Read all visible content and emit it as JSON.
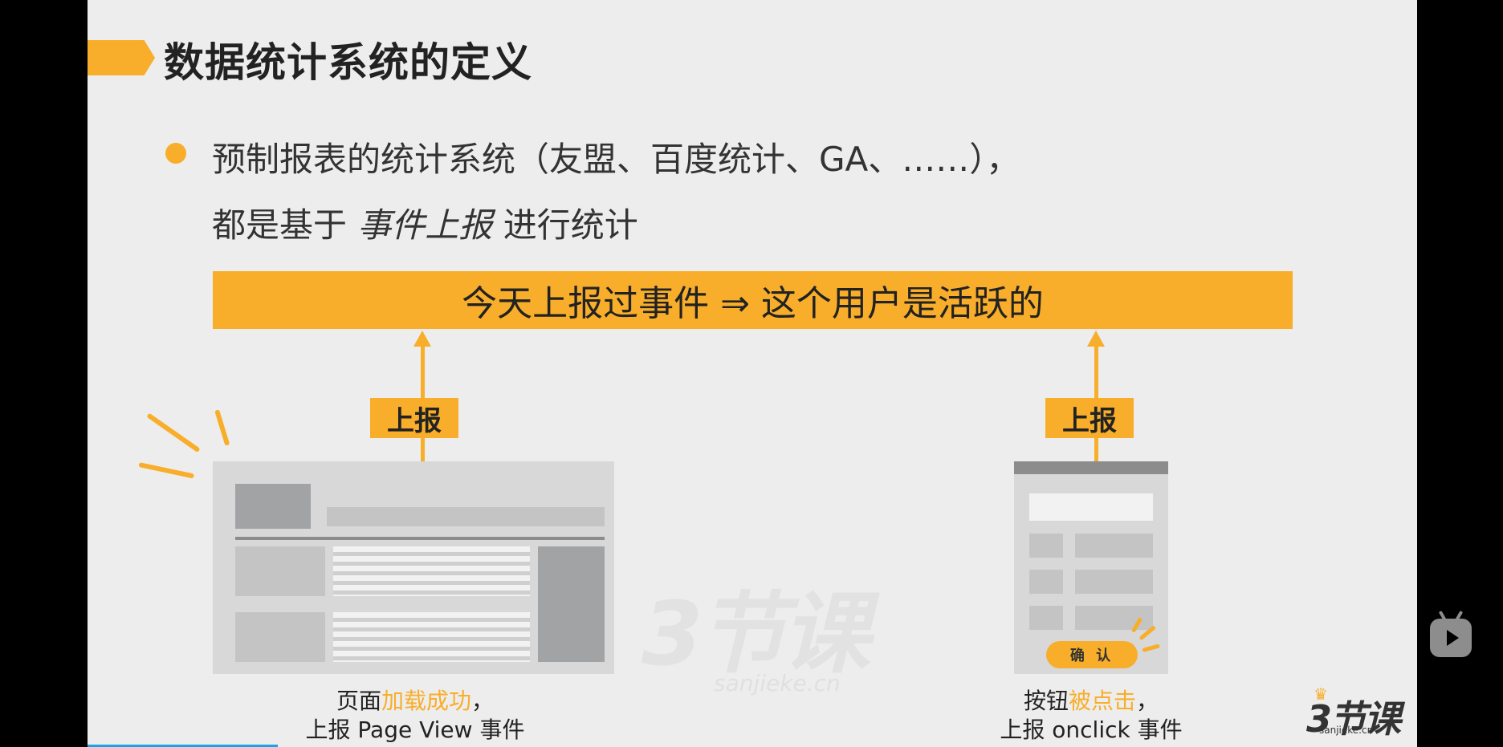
{
  "slide": {
    "title": "数据统计系统的定义",
    "bullet": {
      "line1": "预制报表的统计系统（友盟、百度统计、GA、……），",
      "line2_prefix": "都是基于 ",
      "line2_em": "事件上报",
      "line2_suffix": " 进行统计"
    },
    "banner": "今天上报过事件 ⇒ 这个用户是活跃的",
    "left_tag": "上报",
    "right_tag": "上报",
    "confirm_button": "确 认",
    "caption_left": {
      "prefix": "页面",
      "highlight": "加载成功",
      "suffix": "，",
      "line2": "上报 Page View 事件"
    },
    "caption_right": {
      "prefix": "按钮",
      "highlight": "被点击",
      "suffix": "，",
      "line2": "上报 onclick 事件"
    },
    "watermark": "3节课",
    "watermark_sub": "sanjieke.cn",
    "logo": "3节课",
    "logo_sub": "sanjieke.cn"
  },
  "player": {
    "play_icon": "bilibili-play-icon",
    "progress_fraction": 0.185
  },
  "colors": {
    "accent": "#f8ae2a",
    "slide_bg": "#ededed",
    "frame_bg": "#000000",
    "progress": "#1aa3e8"
  }
}
